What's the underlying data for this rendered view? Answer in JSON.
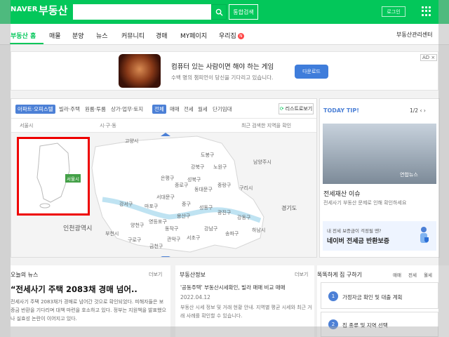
{
  "header": {
    "logo": "NAVER",
    "service": "부동산",
    "search_placeholder": "",
    "unified_search": "통합검색",
    "login": "로그인"
  },
  "nav": {
    "items": [
      {
        "label": "부동산 홈"
      },
      {
        "label": "매물"
      },
      {
        "label": "분양"
      },
      {
        "label": "뉴스"
      },
      {
        "label": "커뮤니티"
      },
      {
        "label": "경매"
      },
      {
        "label": "MY페이지"
      },
      {
        "label": "우리집"
      }
    ],
    "badge": "N",
    "right_link": "부동산관리센터"
  },
  "banner": {
    "title": "컴퓨터 있는 사람이면 해야 하는 게임",
    "subtitle": "수백 명의 챔피언이 당신을 기다리고 있습니다.",
    "button": "다운로드",
    "ad": "AD ×"
  },
  "map": {
    "chips": [
      "아파트·오피스텔",
      "빌라·주택",
      "원룸·투룸",
      "상가·업무·토지",
      "전체",
      "매매",
      "전세",
      "월세",
      "단기임대"
    ],
    "list_button": "리스트로보기",
    "filter_left": "서울시",
    "filter_mid": "시·구·동",
    "filter_right": "최근 검색한 지역을 확인",
    "mini_region": "서울시",
    "regions": [
      {
        "name": "도봉구"
      },
      {
        "name": "노원구"
      },
      {
        "name": "강북구"
      },
      {
        "name": "은평구"
      },
      {
        "name": "성북구"
      },
      {
        "name": "종로구"
      },
      {
        "name": "중랑구"
      },
      {
        "name": "동대문구"
      },
      {
        "name": "서대문구"
      },
      {
        "name": "마포구"
      },
      {
        "name": "중구"
      },
      {
        "name": "성동구"
      },
      {
        "name": "광진구"
      },
      {
        "name": "강서구"
      },
      {
        "name": "양천구"
      },
      {
        "name": "영등포구"
      },
      {
        "name": "용산구"
      },
      {
        "name": "강남구"
      },
      {
        "name": "송파구"
      },
      {
        "name": "강동구"
      },
      {
        "name": "구로구"
      },
      {
        "name": "금천구"
      },
      {
        "name": "관악구"
      },
      {
        "name": "동작구"
      },
      {
        "name": "서초구"
      },
      {
        "name": "구리시"
      },
      {
        "name": "남양주시"
      },
      {
        "name": "고양시"
      },
      {
        "name": "부천시"
      },
      {
        "name": "하남시"
      },
      {
        "name": "경기도"
      },
      {
        "name": "인천광역시"
      }
    ]
  },
  "today": {
    "title": "TODAY TIP!",
    "pager": "1/2",
    "image_label": "연합뉴스",
    "headline": "전세재산 이슈",
    "desc": "전세사기 부동산 문제로 인해 확인하세요",
    "promo_small": "내 전세 보증금이 걱정될 땐?",
    "promo_big": "네이버 전세금 반환보증"
  },
  "news": {
    "title": "오늘의 뉴스",
    "more": "더보기",
    "headline": "“전세사기 주택 2083채 경매 넘어..",
    "body": "전세사기 주택 2083채가 경매로 넘어간 것으로 확인되었다. 피해자들은 보증금 반환을 기다리며 대책 마련을 호소하고 있다. 정부는 지원책을 발표했으나 실효성 논란이 이어지고 있다."
  },
  "realty": {
    "title": "부동산정보",
    "more": "더보기",
    "headline": "'공동주택' 부동산시세확인, 빌라 매매 비교 매매",
    "date": "2022.04.12",
    "body": "부동산 시세 정보 및 거래 현황 안내. 지역별 평균 시세와 최근 거래 사례를 확인할 수 있습니다."
  },
  "faq": {
    "title": "똑똑하게 집 구하기",
    "tabs": [
      "매매",
      "전세",
      "월세"
    ],
    "items": [
      {
        "num": "1",
        "text": "가정자금 확인 및 대출 계획"
      },
      {
        "num": "2",
        "text": "집 종류 및 지역 선택"
      }
    ]
  }
}
